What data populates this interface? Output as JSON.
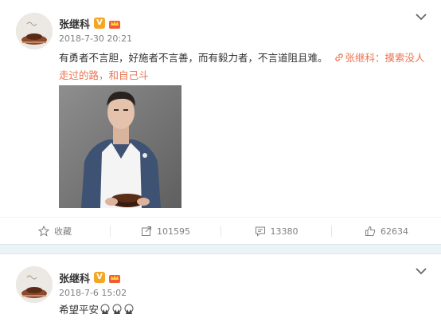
{
  "post1": {
    "username": "张继科",
    "verified_badge": "V",
    "timestamp": "2018-7-30 20:21",
    "text_part1": "有勇者不言胆，好施者不言善，而有毅力者，不言道阻且难。",
    "topic_link": "张继科：摸索没人走过的路，和自己斗",
    "actions": {
      "favorite_label": "收藏",
      "share_count": "101595",
      "comment_count": "13380",
      "like_count": "62634"
    }
  },
  "post2": {
    "username": "张继科",
    "verified_badge": "V",
    "timestamp": "2018-7-6 15:02",
    "text": "希望平安"
  },
  "colors": {
    "link": "#eb7350",
    "badge": "#f5a623",
    "page_bg": "#eef5f7"
  },
  "icons": [
    "chevron-down-icon",
    "star-icon",
    "share-icon",
    "comment-icon",
    "like-icon",
    "link-icon",
    "crown-icon",
    "verified-icon",
    "pray-emoji-icon"
  ]
}
